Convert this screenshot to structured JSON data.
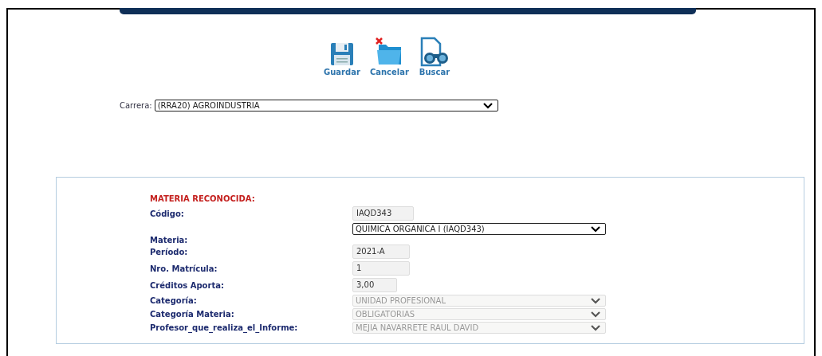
{
  "toolbar": [
    {
      "kind": "save",
      "label": "Guardar"
    },
    {
      "kind": "cancel",
      "label": "Cancelar"
    },
    {
      "kind": "search",
      "label": "Buscar"
    }
  ],
  "carrera": {
    "label": "Carrera:",
    "value": "(RRA20) AGROINDUSTRIA"
  },
  "panel": {
    "title": "MATERIA RECONOCIDA:",
    "fields": [
      {
        "label": "Código:",
        "kind": "text",
        "value": "IAQD343",
        "disabled": false
      },
      {
        "label": "Materia:",
        "kind": "select",
        "value": "QUIMICA ORGANICA I (IAQD343)",
        "disabled": false
      },
      {
        "label": "Período:",
        "kind": "text",
        "value": "2021-A",
        "disabled": false
      },
      {
        "label": "Nro. Matrícula:",
        "kind": "text",
        "value": "1",
        "disabled": false
      },
      {
        "label": "Créditos Aporta:",
        "kind": "text",
        "value": "3,00",
        "disabled": false
      },
      {
        "label": "Categoría:",
        "kind": "select",
        "value": "UNIDAD PROFESIONAL",
        "disabled": true
      },
      {
        "label": "Categoría Materia:",
        "kind": "select",
        "value": "OBLIGATORIAS",
        "disabled": true
      },
      {
        "label": "Profesor_que_realiza_el_Informe:",
        "kind": "select",
        "value": "MEJIA NAVARRETE RAUL DAVID",
        "disabled": true
      }
    ]
  }
}
